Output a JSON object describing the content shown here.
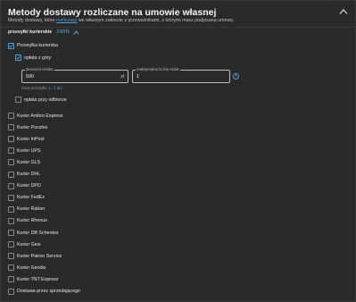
{
  "header": {
    "title": "Metody dostawy rozliczane na umowie własnej",
    "subtitle_before": "Metody dostawy, które ",
    "subtitle_link": "rozliczasz",
    "subtitle_after": " we własnym zakresie z przewoźnikami, z którymi masz podpisaną umowę."
  },
  "section": {
    "title": "przesyłki kurierskie",
    "toggle_label": "ZWIŃ"
  },
  "courier_main": {
    "label": "Przesyłka kurierska",
    "checked": true,
    "prepaid": {
      "label": "opłata z góry",
      "checked": true,
      "price_field": {
        "label": "pierwsza sztuka",
        "value": "500",
        "unit": "zł"
      },
      "qty_field": {
        "label": "maksymalna liczba sztuk",
        "value": "1"
      },
      "hint_prefix": "Czas przesyłki: ",
      "hint_value": "1 - 2 dni"
    },
    "cod": {
      "label": "opłata przy odbiorze",
      "checked": false
    }
  },
  "couriers": [
    "Kurier Ambro Express",
    "Kurier Pocztex",
    "Kurier InPost",
    "Kurier UPS",
    "Kurier GLS",
    "Kurier DHL",
    "Kurier DPD",
    "Kurier FedEx",
    "Kurier Raben",
    "Kurier Rhenus",
    "Kurier DB Schenker",
    "Kurier Geis",
    "Kurier Patron Service",
    "Kurier Geodis",
    "Kurier TNT Express",
    "Dostawa przez sprzedającego"
  ],
  "colors": {
    "accent": "#4aa3df",
    "background": "#2a2a2a",
    "text": "#e6e6e6"
  }
}
